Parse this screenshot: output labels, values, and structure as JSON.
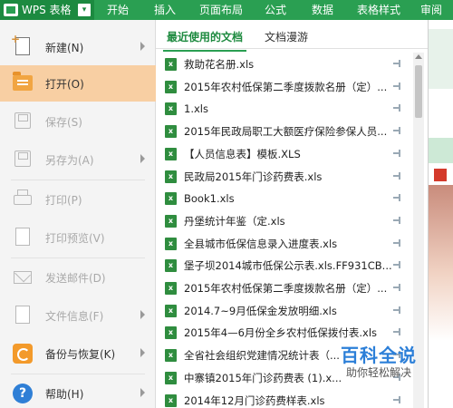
{
  "app": {
    "title": "WPS 表格",
    "menu_caret": "▾"
  },
  "ribbon_tabs": [
    "开始",
    "插入",
    "页面布局",
    "公式",
    "数据",
    "表格样式",
    "审阅"
  ],
  "left_menu": [
    {
      "label": "新建(N)",
      "icon": "new-doc-icon",
      "arrow": true,
      "state": "normal"
    },
    {
      "label": "打开(O)",
      "icon": "open-folder-icon",
      "arrow": false,
      "state": "active"
    },
    {
      "label": "保存(S)",
      "icon": "save-icon",
      "arrow": false,
      "state": "disabled"
    },
    {
      "label": "另存为(A)",
      "icon": "save-as-icon",
      "arrow": true,
      "state": "disabled"
    },
    {
      "label": "打印(P)",
      "icon": "print-icon",
      "arrow": false,
      "state": "disabled"
    },
    {
      "label": "打印预览(V)",
      "icon": "print-preview-icon",
      "arrow": false,
      "state": "disabled"
    },
    {
      "label": "发送邮件(D)",
      "icon": "mail-icon",
      "arrow": false,
      "state": "disabled"
    },
    {
      "label": "文件信息(F)",
      "icon": "file-info-icon",
      "arrow": true,
      "state": "disabled"
    },
    {
      "label": "备份与恢复(K)",
      "icon": "backup-icon",
      "arrow": true,
      "state": "normal"
    },
    {
      "label": "帮助(H)",
      "icon": "help-icon",
      "arrow": true,
      "state": "normal"
    }
  ],
  "tabs": {
    "recent": "最近使用的文档",
    "browse": "文档漫游"
  },
  "recent_files": [
    "救助花名册.xls",
    "2015年农村低保第二季度拨款名册（定）...",
    "1.xls",
    "2015年民政局职工大额医疗保险参保人员...",
    "【人员信息表】模板.XLS",
    "民政局2015年门诊药费表.xls",
    "Book1.xls",
    "丹堡统计年鉴（定.xls",
    "全县城市低保信息录入进度表.xls",
    "堡子坝2014城市低保公示表.xls.FF931CB...",
    "2015年农村低保第二季度拨款名册（定）...",
    "2014.7~9月低保金发放明细.xls",
    "2015年4—6月份全乡农村低保拨付表.xls",
    "全省社会组织党建情况统计表（...",
    "中寨镇2015年门诊药费表 (1).x...",
    "2014年12月门诊药费样表.xls"
  ],
  "watermark": {
    "title": "百科全说",
    "subtitle": "助你轻松解决"
  },
  "colors": {
    "brand_green": "#2a9f52",
    "active_item": "#f8cfa3"
  }
}
